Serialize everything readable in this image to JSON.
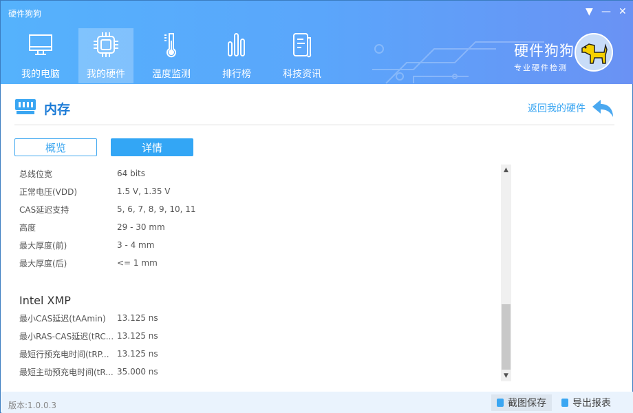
{
  "app": {
    "title": "硬件狗狗",
    "brand_name": "硬件狗狗",
    "brand_slogan": "专业硬件检测"
  },
  "nav": [
    {
      "label": "我的电脑",
      "icon": "monitor-icon"
    },
    {
      "label": "我的硬件",
      "icon": "chip-icon",
      "active": true
    },
    {
      "label": "温度监测",
      "icon": "thermometer-icon"
    },
    {
      "label": "排行榜",
      "icon": "bar-chart-icon"
    },
    {
      "label": "科技资讯",
      "icon": "news-icon"
    }
  ],
  "section": {
    "title": "内存",
    "back_label": "返回我的硬件"
  },
  "tabs": [
    {
      "label": "概览"
    },
    {
      "label": "详情",
      "active": true
    }
  ],
  "rows": [
    {
      "k": "总线位宽",
      "v": "64 bits"
    },
    {
      "k": "正常电压(VDD)",
      "v": "1.5 V, 1.35 V"
    },
    {
      "k": "CAS延迟支持",
      "v": "5, 6, 7, 8, 9, 10, 11"
    },
    {
      "k": "高度",
      "v": "29 - 30 mm"
    },
    {
      "k": "最大厚度(前)",
      "v": "3 - 4 mm"
    },
    {
      "k": "最大厚度(后)",
      "v": "<= 1 mm"
    }
  ],
  "xmp": {
    "title": "Intel XMP",
    "rows": [
      {
        "k": "最小CAS延迟(tAAmin)",
        "v": "13.125 ns"
      },
      {
        "k": "最小RAS-CAS延迟(tRC...",
        "v": "13.125 ns"
      },
      {
        "k": "最短行预充电时间(tRP...",
        "v": "13.125 ns"
      },
      {
        "k": "最短主动预充电时间(tR...",
        "v": "35.000 ns"
      }
    ]
  },
  "footer": {
    "version": "版本:1.0.0.3",
    "screenshot_label": "截图保存",
    "export_label": "导出报表"
  }
}
